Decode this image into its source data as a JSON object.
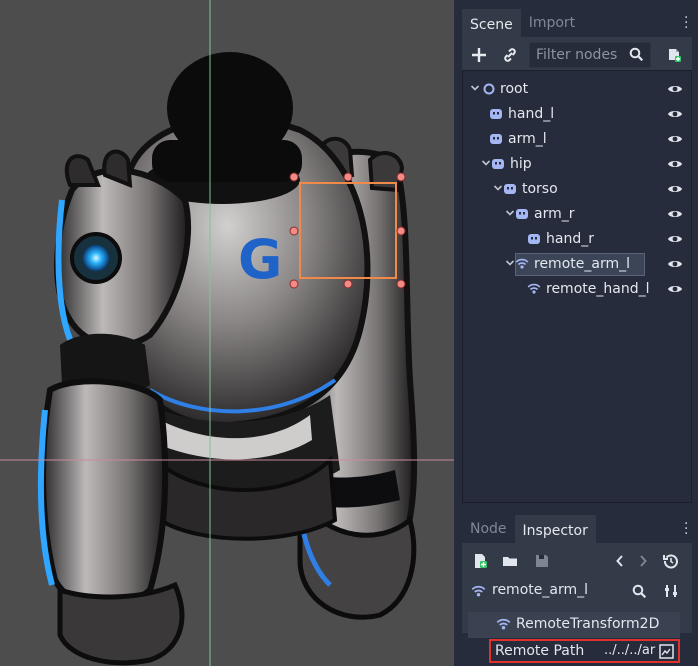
{
  "scene_tabs": [
    {
      "label": "Scene",
      "active": true
    },
    {
      "label": "Import",
      "active": false
    }
  ],
  "scene_filter": {
    "placeholder": "Filter nodes"
  },
  "tree": [
    {
      "label": "root",
      "icon": "node2d-circle-icon",
      "expanded": true
    },
    {
      "label": "hand_l",
      "icon": "sprite-icon"
    },
    {
      "label": "arm_l",
      "icon": "sprite-icon"
    },
    {
      "label": "hip",
      "icon": "sprite-icon",
      "expanded": true
    },
    {
      "label": "torso",
      "icon": "sprite-icon",
      "expanded": true
    },
    {
      "label": "arm_r",
      "icon": "sprite-icon",
      "expanded": true
    },
    {
      "label": "hand_r",
      "icon": "sprite-icon"
    },
    {
      "label": "remote_arm_l",
      "icon": "remote-transform-icon",
      "expanded": true,
      "selected": true
    },
    {
      "label": "remote_hand_l",
      "icon": "remote-transform-icon"
    }
  ],
  "inspector_tabs": [
    {
      "label": "Node",
      "active": false
    },
    {
      "label": "Inspector",
      "active": true
    }
  ],
  "inspector": {
    "object_name": "remote_arm_l",
    "section_title": "RemoteTransform2D",
    "property_key": "Remote Path",
    "property_value": "../../../ar"
  },
  "colors": {
    "viewport_bg": "#4d4d4d",
    "dock_bg": "#262c3b",
    "selection_box": "#f08a4b",
    "handle": "#f08a8a",
    "highlight_border": "#e2312c"
  }
}
